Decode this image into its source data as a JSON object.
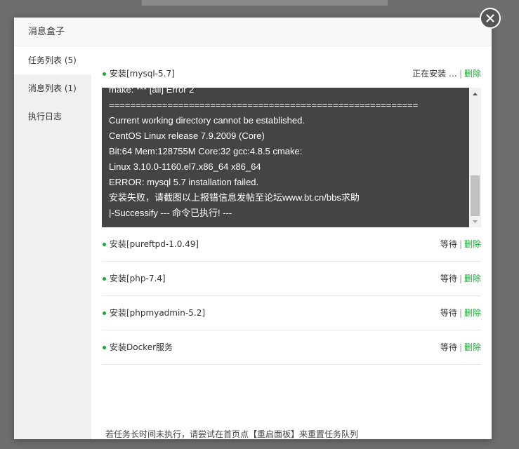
{
  "modal": {
    "title": "消息盒子"
  },
  "sidebar": {
    "items": [
      {
        "label": "任务列表 (5)",
        "active": true
      },
      {
        "label": "消息列表 (1)",
        "active": false
      },
      {
        "label": "执行日志",
        "active": false
      }
    ]
  },
  "current_task": {
    "name": "安装[mysql-5.7]",
    "status": "正在安装 …",
    "separator": "|",
    "delete_label": "删除"
  },
  "log": {
    "lines": [
      "make: *** [all] Error 2",
      "==========================================================",
      "Current working directory cannot be established.",
      "CentOS Linux release 7.9.2009 (Core)",
      "Bit:64 Mem:128755M Core:32 gcc:4.8.5 cmake:",
      "Linux 3.10.0-1160.el7.x86_64 x86_64",
      "ERROR: mysql 5.7 installation failed.",
      "安装失败，请截图以上报错信息发帖至论坛www.bt.cn/bbs求助",
      "|-Successify --- 命令已执行! ---"
    ]
  },
  "queue": [
    {
      "name": "安装[pureftpd-1.0.49]",
      "status": "等待",
      "separator": "|",
      "delete_label": "删除"
    },
    {
      "name": "安装[php-7.4]",
      "status": "等待",
      "separator": "|",
      "delete_label": "删除"
    },
    {
      "name": "安装[phpmyadmin-5.2]",
      "status": "等待",
      "separator": "|",
      "delete_label": "删除"
    },
    {
      "name": "安装Docker服务",
      "status": "等待",
      "separator": "|",
      "delete_label": "删除"
    }
  ],
  "hint": "若任务长时间未执行，请尝试在首页点【重启面板】来重置任务队列",
  "colors": {
    "accent": "#20a53a",
    "log_bg": "#444444"
  },
  "icons": {
    "close": "close-icon",
    "scroll_up": "arrow-up-icon",
    "scroll_down": "arrow-down-icon"
  }
}
